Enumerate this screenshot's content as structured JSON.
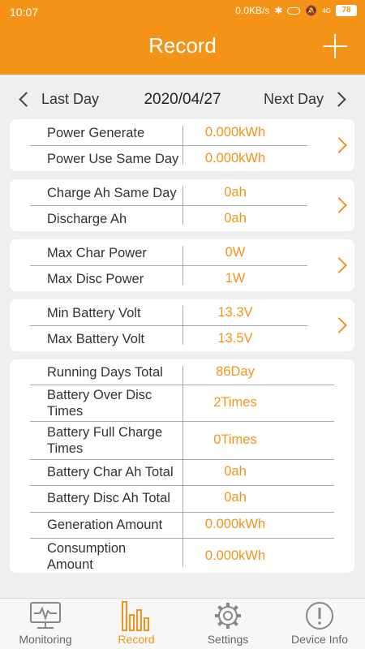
{
  "status": {
    "time": "10:07",
    "speed": "0.0KB/s",
    "network": "4G",
    "battery": "78"
  },
  "header": {
    "title": "Record"
  },
  "nav": {
    "prev_label": "Last Day",
    "date": "2020/04/27",
    "next_label": "Next Day"
  },
  "cards": [
    {
      "rows": [
        {
          "label": "Power Generate",
          "value": "0.000kWh"
        },
        {
          "label": "Power Use Same Day",
          "value": "0.000kWh"
        }
      ]
    },
    {
      "rows": [
        {
          "label": "Charge Ah Same Day",
          "value": "0ah"
        },
        {
          "label": "Discharge Ah",
          "value": "0ah"
        }
      ]
    },
    {
      "rows": [
        {
          "label": "Max Char Power",
          "value": "0W"
        },
        {
          "label": "Max Disc Power",
          "value": "1W"
        }
      ]
    },
    {
      "rows": [
        {
          "label": "Min Battery Volt",
          "value": "13.3V"
        },
        {
          "label": "Max Battery Volt",
          "value": "13.5V"
        }
      ]
    }
  ],
  "totals": {
    "rows": [
      {
        "label": "Running Days Total",
        "value": "86Day"
      },
      {
        "label": "Battery Over Disc Times",
        "value": "2Times"
      },
      {
        "label": "Battery Full Charge Times",
        "value": "0Times"
      },
      {
        "label": "Battery Char Ah Total",
        "value": "0ah"
      },
      {
        "label": "Battery Disc Ah Total",
        "value": "0ah"
      },
      {
        "label": "Generation Amount",
        "value": "0.000kWh"
      },
      {
        "label": "Consumption Amount",
        "value": "0.000kWh"
      }
    ]
  },
  "tabs": [
    {
      "label": "Monitoring",
      "icon": "monitor-icon"
    },
    {
      "label": "Record",
      "icon": "bar-chart-icon",
      "active": true
    },
    {
      "label": "Settings",
      "icon": "gear-icon"
    },
    {
      "label": "Device Info",
      "icon": "info-icon"
    }
  ],
  "colors": {
    "accent": "#f39318",
    "background": "#efefef"
  }
}
